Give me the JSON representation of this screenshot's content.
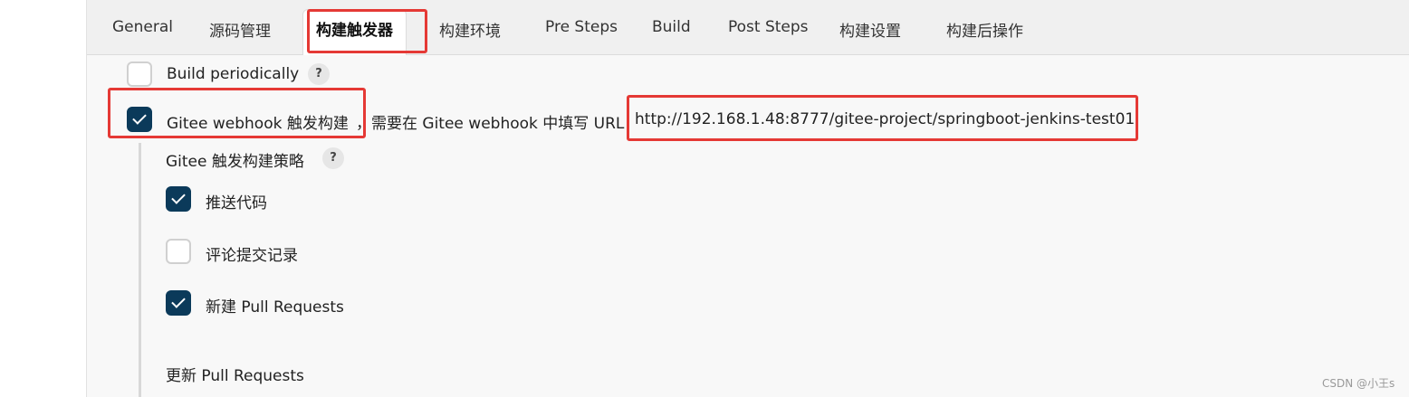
{
  "tabs": [
    {
      "label": "General"
    },
    {
      "label": "源码管理"
    },
    {
      "label": "构建触发器",
      "active": true
    },
    {
      "label": "构建环境"
    },
    {
      "label": "Pre Steps"
    },
    {
      "label": "Build"
    },
    {
      "label": "Post Steps"
    },
    {
      "label": "构建设置"
    },
    {
      "label": "构建后操作"
    }
  ],
  "triggers": {
    "build_periodically": {
      "label": "Build periodically",
      "checked": false,
      "help": "?"
    },
    "gitee_webhook": {
      "label": "Gitee webhook 触发构建",
      "note": "，需要在 Gitee webhook 中填写 URL",
      "url": "http://192.168.1.48:8777/gitee-project/springboot-jenkins-test01",
      "checked": true
    }
  },
  "strategy": {
    "title": "Gitee 触发构建策略",
    "help": "?",
    "options": [
      {
        "label": "推送代码",
        "checked": true
      },
      {
        "label": "评论提交记录",
        "checked": false
      },
      {
        "label": "新建 Pull Requests",
        "checked": true
      }
    ],
    "update_pr_label": "更新 Pull Requests"
  },
  "watermark": "CSDN @小王s",
  "colors": {
    "checkbox_checked": "#0b3a5a",
    "highlight_box": "#e53935"
  }
}
